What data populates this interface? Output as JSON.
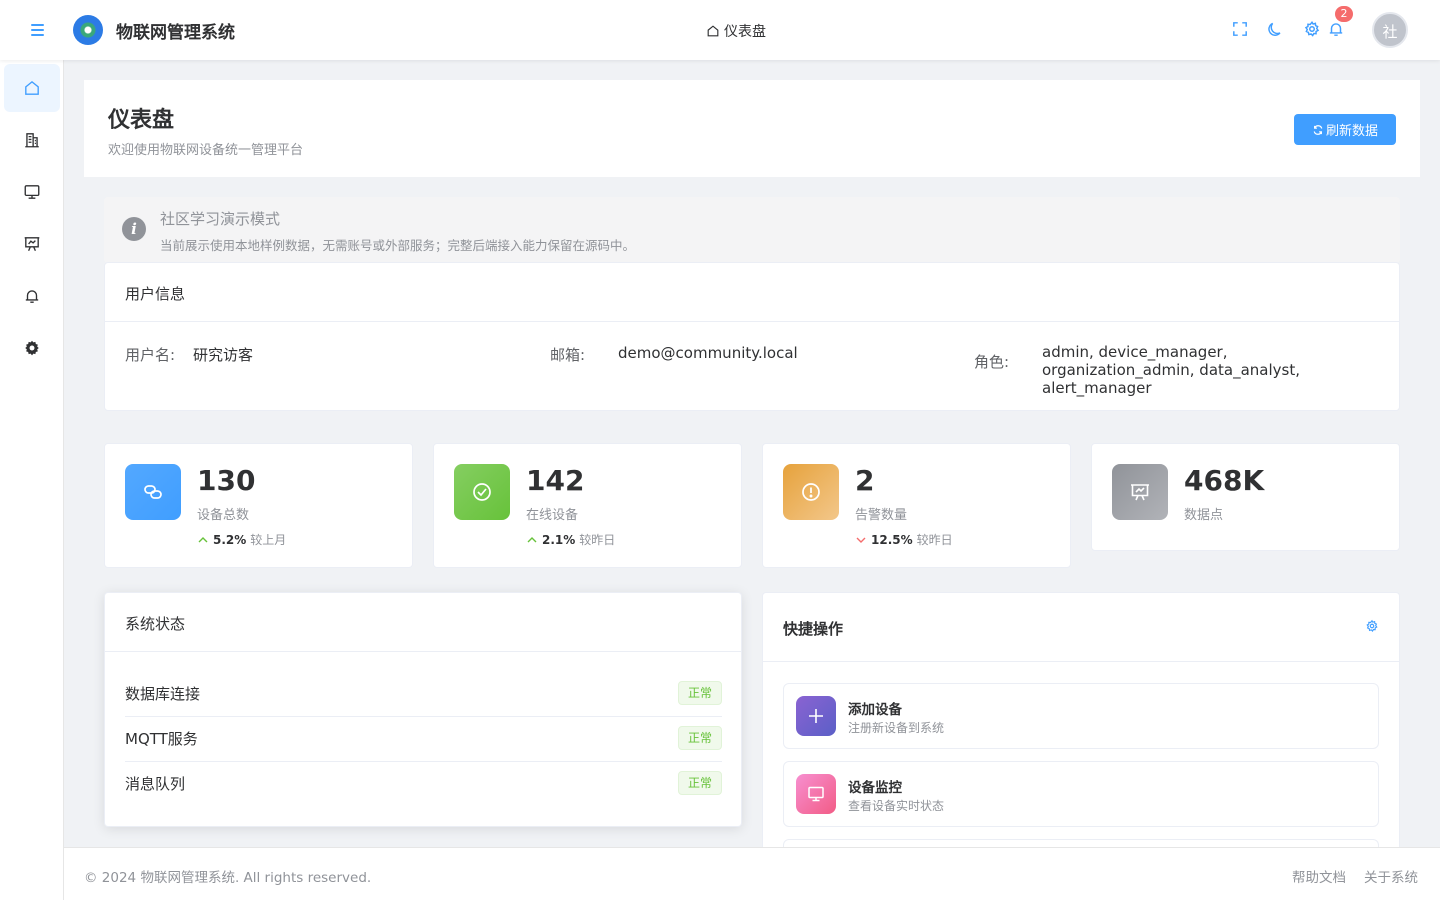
{
  "header": {
    "app_title": "物联网管理系统",
    "breadcrumb": "仪表盘",
    "notification_count": "2",
    "avatar_text": "社"
  },
  "sidebar": {
    "items": [
      {
        "icon": "home-icon",
        "active": true
      },
      {
        "icon": "building-icon",
        "active": false
      },
      {
        "icon": "monitor-icon",
        "active": false
      },
      {
        "icon": "presentation-icon",
        "active": false
      },
      {
        "icon": "bell-icon",
        "active": false
      },
      {
        "icon": "gear-icon",
        "active": false
      }
    ]
  },
  "page": {
    "title": "仪表盘",
    "subtitle": "欢迎使用物联网设备统一管理平台",
    "refresh_label": "刷新数据"
  },
  "notice": {
    "title": "社区学习演示模式",
    "description": "当前展示使用本地样例数据，无需账号或外部服务；完整后端接入能力保留在源码中。"
  },
  "user_info": {
    "title": "用户信息",
    "username_label": "用户名:",
    "username": "研究访客",
    "email_label": "邮箱:",
    "email": "demo@community.local",
    "role_label": "角色:",
    "roles": "admin, device_manager, organization_admin, data_analyst, alert_manager"
  },
  "stats": [
    {
      "value": "130",
      "label": "设备总数",
      "trend": "up",
      "pct": "5.2%",
      "compare": "较上月",
      "icon": "link-icon",
      "color": "#409eff"
    },
    {
      "value": "142",
      "label": "在线设备",
      "trend": "up",
      "pct": "2.1%",
      "compare": "较昨日",
      "icon": "check-circle-icon",
      "color": "#67c23a"
    },
    {
      "value": "2",
      "label": "告警数量",
      "trend": "down",
      "pct": "12.5%",
      "compare": "较昨日",
      "icon": "warning-circle-icon",
      "color": "#e6a23c"
    },
    {
      "value": "468K",
      "label": "数据点",
      "icon": "data-board-icon",
      "color": "#909399"
    }
  ],
  "system_status": {
    "title": "系统状态",
    "items": [
      {
        "name": "数据库连接",
        "status": "正常"
      },
      {
        "name": "MQTT服务",
        "status": "正常"
      },
      {
        "name": "消息队列",
        "status": "正常"
      }
    ]
  },
  "quick_actions": {
    "title": "快捷操作",
    "items": [
      {
        "name": "添加设备",
        "desc": "注册新设备到系统",
        "icon": "plus-icon"
      },
      {
        "name": "设备监控",
        "desc": "查看设备实时状态",
        "icon": "monitor-icon"
      }
    ]
  },
  "footer": {
    "copyright": "© 2024 物联网管理系统. All rights reserved.",
    "help": "帮助文档",
    "about": "关于系统"
  },
  "colors": {
    "primary": "#409eff",
    "success": "#67c23a",
    "warning": "#e6a23c",
    "danger": "#f56c6c",
    "info": "#909399"
  }
}
